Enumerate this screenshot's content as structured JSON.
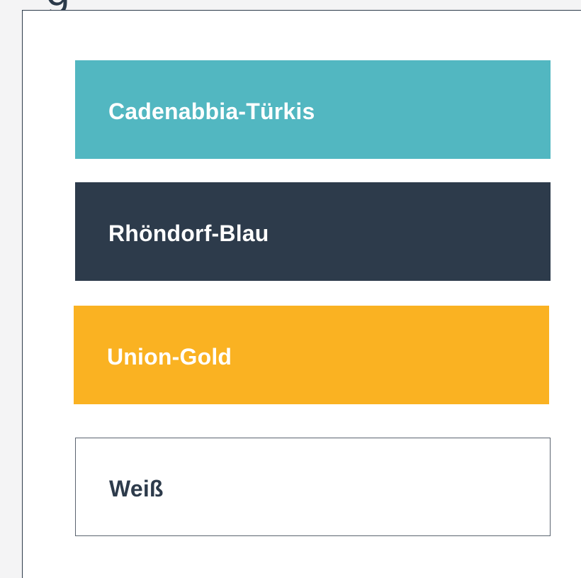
{
  "heading": {
    "fragment": "g"
  },
  "swatches": [
    {
      "label": "Cadenabbia-Türkis",
      "background": "#52b7c1",
      "text_color": "#ffffff"
    },
    {
      "label": "Rhöndorf-Blau",
      "background": "#2d3b4b",
      "text_color": "#ffffff"
    },
    {
      "label": "Union-Gold",
      "background": "#fab222",
      "text_color": "#ffffff"
    },
    {
      "label": "Weiß",
      "background": "#ffffff",
      "text_color": "#2d3b4b"
    }
  ]
}
